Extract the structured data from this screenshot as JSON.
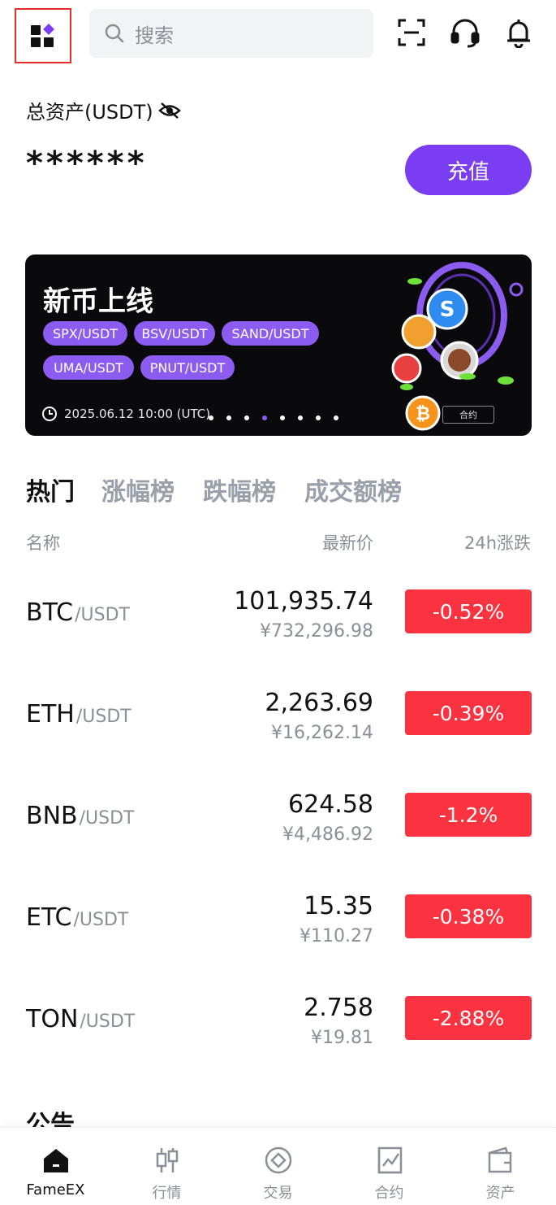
{
  "header": {
    "search_placeholder": "搜索",
    "icons": [
      "menu-icon",
      "search-icon",
      "scan-icon",
      "headset-icon",
      "bell-icon"
    ]
  },
  "assets": {
    "label": "总资产(USDT)",
    "value": "******",
    "deposit_label": "充值"
  },
  "banner": {
    "title": "新币上线",
    "pairs": [
      "SPX/USDT",
      "BSV/USDT",
      "SAND/USDT",
      "UMA/USDT",
      "PNUT/USDT"
    ],
    "date": "2025.06.12 10:00 (UTC)",
    "tag": "合约",
    "slide_count": 8,
    "active_slide": 4
  },
  "tabs": [
    "热门",
    "涨幅榜",
    "跌幅榜",
    "成交额榜"
  ],
  "columns": {
    "name": "名称",
    "price": "最新价",
    "change": "24h涨跌"
  },
  "rows": [
    {
      "base": "BTC",
      "quote": "/USDT",
      "price": "101,935.74",
      "cny": "¥732,296.98",
      "change": "-0.52%"
    },
    {
      "base": "ETH",
      "quote": "/USDT",
      "price": "2,263.69",
      "cny": "¥16,262.14",
      "change": "-0.39%"
    },
    {
      "base": "BNB",
      "quote": "/USDT",
      "price": "624.58",
      "cny": "¥4,486.92",
      "change": "-1.2%"
    },
    {
      "base": "ETC",
      "quote": "/USDT",
      "price": "15.35",
      "cny": "¥110.27",
      "change": "-0.38%"
    },
    {
      "base": "TON",
      "quote": "/USDT",
      "price": "2.758",
      "cny": "¥19.81",
      "change": "-2.88%"
    }
  ],
  "notice_title": "公告",
  "nav": [
    {
      "label": "FameEX",
      "icon": "home-icon"
    },
    {
      "label": "行情",
      "icon": "candlestick-icon"
    },
    {
      "label": "交易",
      "icon": "trade-icon"
    },
    {
      "label": "合约",
      "icon": "contract-chart-icon"
    },
    {
      "label": "资产",
      "icon": "wallet-icon"
    }
  ],
  "colors": {
    "accent": "#7b3df2",
    "down": "#fb3341",
    "pill": "#8c5cf0"
  }
}
